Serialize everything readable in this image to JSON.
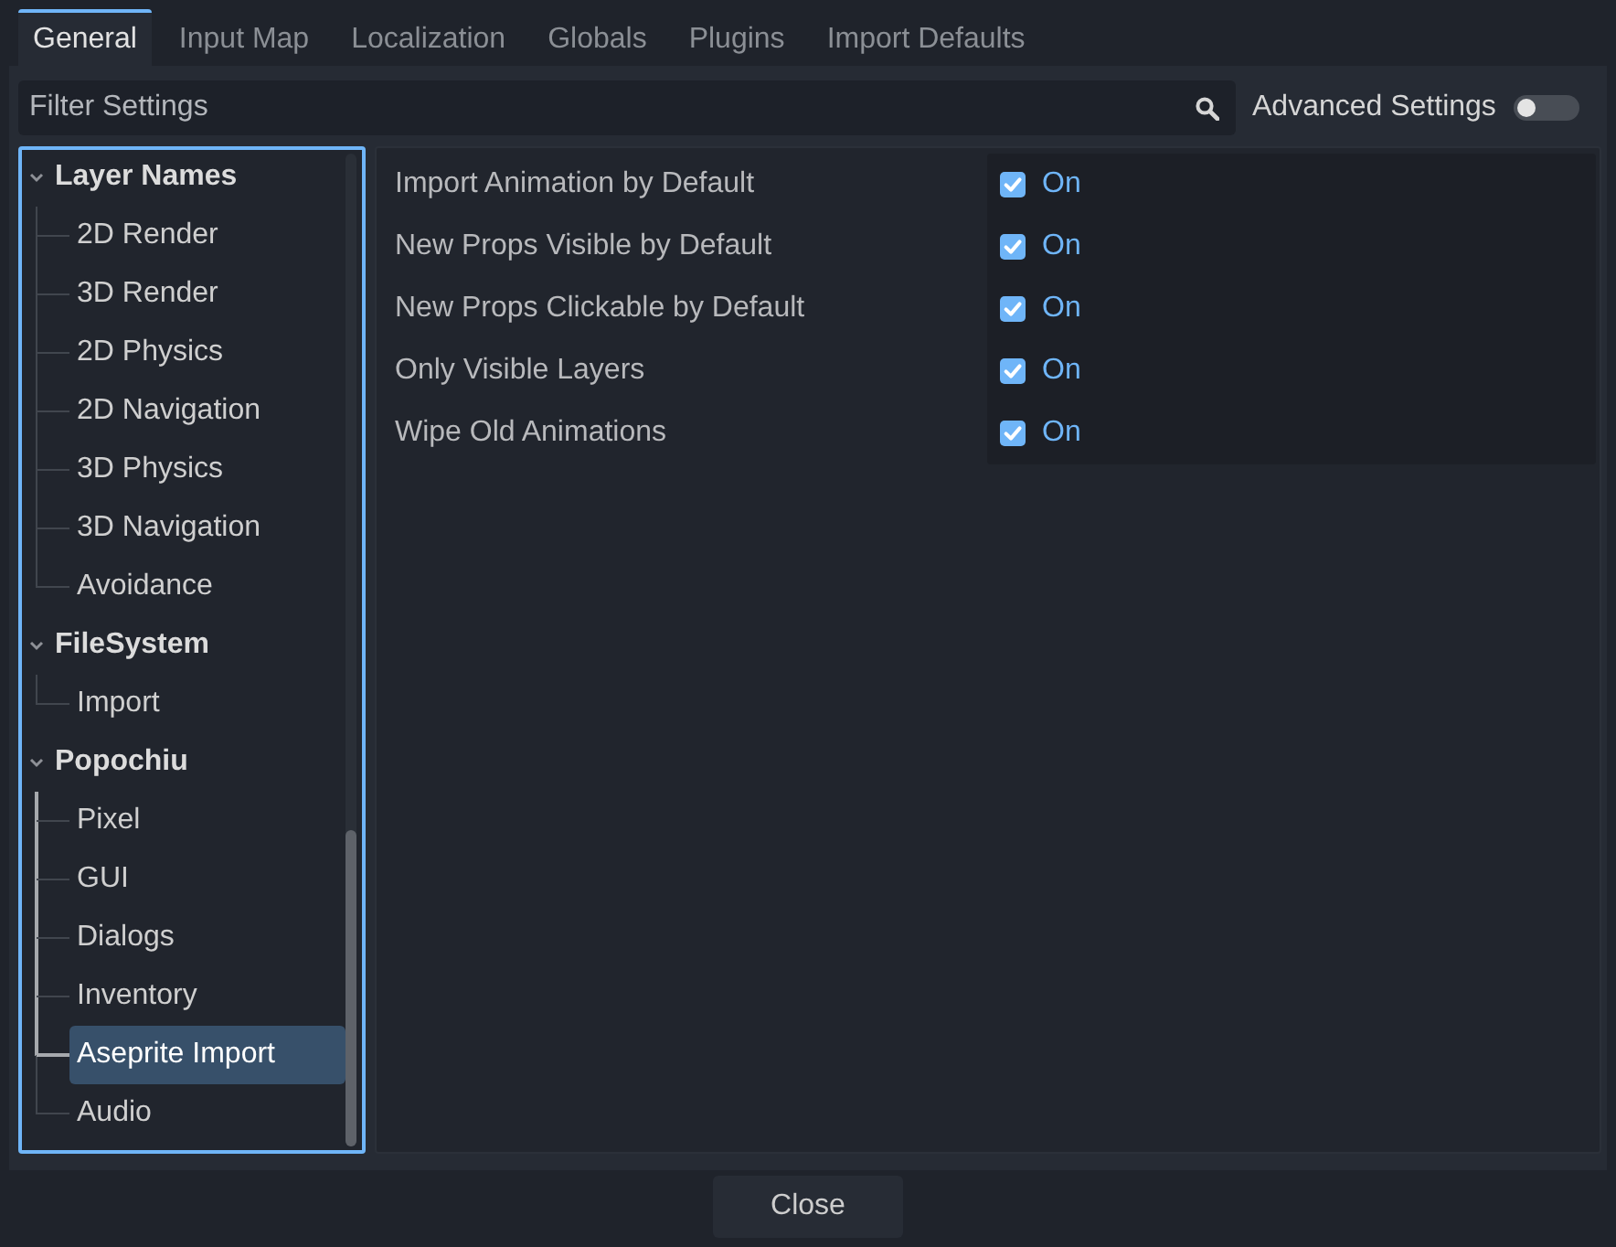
{
  "tabs": [
    {
      "label": "General",
      "selected": true
    },
    {
      "label": "Input Map",
      "selected": false
    },
    {
      "label": "Localization",
      "selected": false
    },
    {
      "label": "Globals",
      "selected": false
    },
    {
      "label": "Plugins",
      "selected": false
    },
    {
      "label": "Import Defaults",
      "selected": false
    }
  ],
  "filter": {
    "placeholder": "Filter Settings"
  },
  "advanced_settings": {
    "label": "Advanced Settings",
    "on": false
  },
  "sidebar": {
    "focused": true,
    "items": [
      {
        "label": "Layer Names",
        "expanded": true,
        "selected": false,
        "children": [
          {
            "label": "2D Render",
            "selected": false
          },
          {
            "label": "3D Render",
            "selected": false
          },
          {
            "label": "2D Physics",
            "selected": false
          },
          {
            "label": "2D Navigation",
            "selected": false
          },
          {
            "label": "3D Physics",
            "selected": false
          },
          {
            "label": "3D Navigation",
            "selected": false
          },
          {
            "label": "Avoidance",
            "selected": false
          }
        ]
      },
      {
        "label": "FileSystem",
        "expanded": true,
        "selected": false,
        "children": [
          {
            "label": "Import",
            "selected": false
          }
        ]
      },
      {
        "label": "Popochiu",
        "expanded": true,
        "selected": false,
        "children": [
          {
            "label": "Pixel",
            "selected": false
          },
          {
            "label": "GUI",
            "selected": false
          },
          {
            "label": "Dialogs",
            "selected": false
          },
          {
            "label": "Inventory",
            "selected": false
          },
          {
            "label": "Aseprite Import",
            "selected": true
          },
          {
            "label": "Audio",
            "selected": false
          }
        ]
      }
    ]
  },
  "properties": [
    {
      "label": "Import Animation by Default",
      "checked": true,
      "value": "On"
    },
    {
      "label": "New Props Visible by Default",
      "checked": true,
      "value": "On"
    },
    {
      "label": "New Props Clickable by Default",
      "checked": true,
      "value": "On"
    },
    {
      "label": "Only Visible Layers",
      "checked": true,
      "value": "On"
    },
    {
      "label": "Wipe Old Animations",
      "checked": true,
      "value": "On"
    }
  ],
  "buttons": [
    "Close"
  ]
}
